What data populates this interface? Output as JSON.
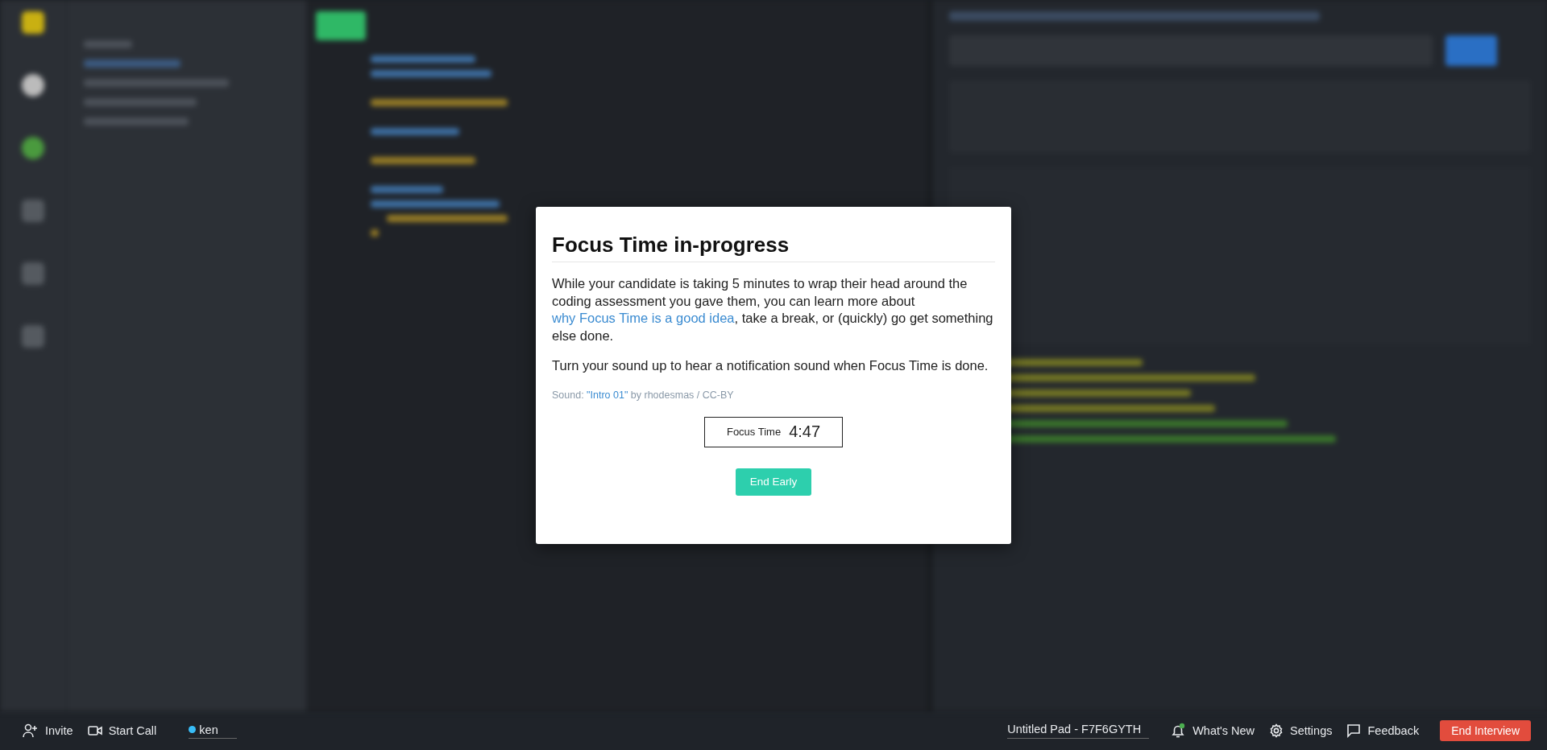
{
  "modal": {
    "title": "Focus Time in-progress",
    "paragraphs": [
      {
        "before": "While your candidate is taking 5 minutes to wrap their head around the coding assessment you gave them, you can learn more about ",
        "link": "why Focus Time is a good idea",
        "after": ", take a break, or (quickly) go get something else done."
      },
      {
        "before": "Turn your sound up to hear a notification sound when Focus Time is done."
      }
    ],
    "credit": {
      "before": "Sound: ",
      "link": "\"Intro 01\"",
      "after": " by rhodesmas / CC-BY"
    },
    "timer": {
      "label": "Focus Time",
      "value": "4:47"
    },
    "button": "End Early"
  },
  "bottom_bar": {
    "left": [
      {
        "kind": "invite",
        "label": "Invite"
      },
      {
        "kind": "call",
        "label": "Start Call"
      }
    ],
    "user": {
      "name": "ken"
    },
    "pad_name": "Untitled Pad - F7F6GYTH",
    "right": [
      {
        "kind": "whats_new",
        "label": "What's New",
        "has_new": true
      },
      {
        "kind": "settings",
        "label": "Settings"
      },
      {
        "kind": "feedback",
        "label": "Feedback"
      }
    ],
    "end_button": "End Interview"
  }
}
